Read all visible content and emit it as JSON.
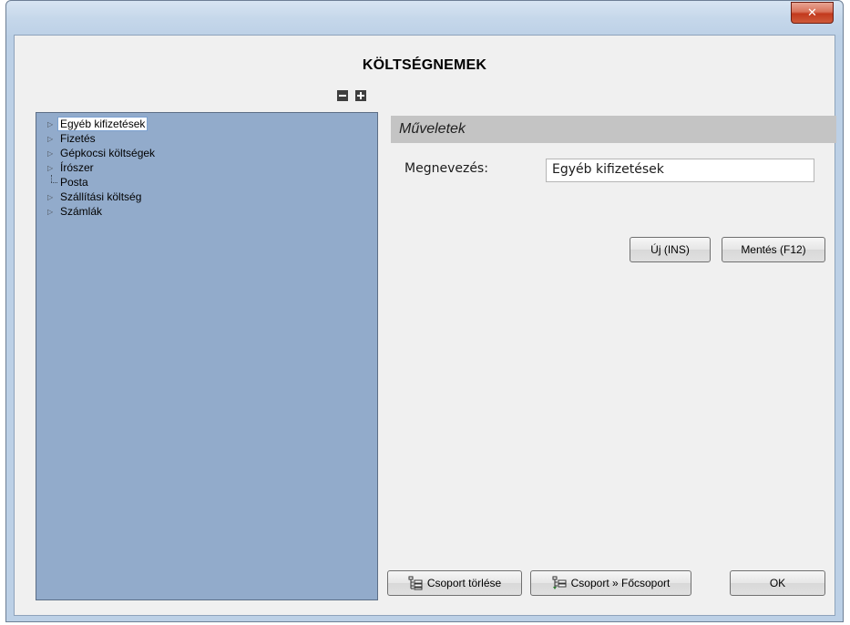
{
  "window": {
    "close_glyph": "✕"
  },
  "title": "KÖLTSÉGNEMEK",
  "tree": {
    "items": [
      {
        "label": "Egyéb kifizetések",
        "expandable": true,
        "selected": true
      },
      {
        "label": "Fizetés",
        "expandable": true
      },
      {
        "label": "Gépkocsi költségek",
        "expandable": true
      },
      {
        "label": "Írószer",
        "expandable": true
      },
      {
        "label": "Posta",
        "expandable": false
      },
      {
        "label": "Szállítási költség",
        "expandable": true
      },
      {
        "label": "Számlák",
        "expandable": true
      }
    ]
  },
  "panel": {
    "header": "Műveletek",
    "name_label": "Megnevezés:",
    "name_value": "Egyéb kifizetések"
  },
  "buttons": {
    "new": "Új (INS)",
    "save": "Mentés (F12)",
    "delete_group": "Csoport törlése",
    "to_main_group": "Csoport » Főcsoport",
    "ok": "OK"
  },
  "icons": {
    "collapse_all": "minus-icon",
    "expand_all": "plus-icon",
    "expand_arrow": "triangle-right-icon",
    "delete_group": "tree-delete-icon",
    "to_main_group": "tree-up-icon",
    "close": "close-icon"
  },
  "colors": {
    "tree_background": "#92abcb",
    "panel_header": "#c4c4c4",
    "close_button": "#c2391d"
  }
}
